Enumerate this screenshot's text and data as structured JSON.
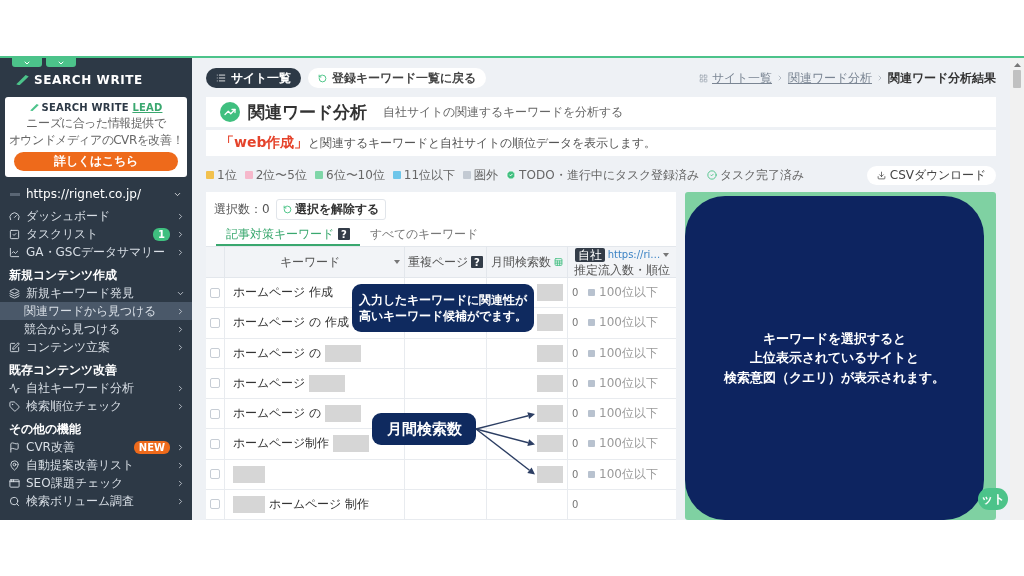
{
  "sidebar": {
    "logo": "SEARCH WRITE",
    "promo": {
      "logo": "SEARCH WRITE",
      "logo_accent": "LEAD",
      "lines": [
        "ニーズに合った情報提供で",
        "オウンドメディアのCVRを改善！"
      ],
      "button": "詳しくはこちら"
    },
    "site": "https://rignet.co.jp/",
    "nav": [
      {
        "kind": "item",
        "label": "ダッシュボード",
        "selected": false
      },
      {
        "kind": "item",
        "label": "タスクリスト",
        "selected": false,
        "badge": {
          "text": "1",
          "color": "#3fbf7f"
        }
      },
      {
        "kind": "item",
        "label": "GA・GSCデータサマリー",
        "selected": false
      },
      {
        "kind": "heading",
        "label": "新規コンテンツ作成"
      },
      {
        "kind": "item",
        "label": "新規キーワード発見",
        "selected": false,
        "expanded": true,
        "children": [
          {
            "label": "関連ワードから見つける",
            "selected": true
          },
          {
            "label": "競合から見つける",
            "selected": false
          }
        ]
      },
      {
        "kind": "item",
        "label": "コンテンツ立案",
        "selected": false
      },
      {
        "kind": "heading",
        "label": "既存コンテンツ改善"
      },
      {
        "kind": "item",
        "label": "自社キーワード分析",
        "selected": false
      },
      {
        "kind": "item",
        "label": "検索順位チェック",
        "selected": false
      },
      {
        "kind": "heading",
        "label": "その他の機能"
      },
      {
        "kind": "item",
        "label": "CVR改善",
        "selected": false,
        "badge": {
          "text": "NEW",
          "color": "#ee6a1b"
        }
      },
      {
        "kind": "item",
        "label": "自動提案改善リスト",
        "selected": false
      },
      {
        "kind": "item",
        "label": "SEO課題チェック",
        "selected": false
      },
      {
        "kind": "item",
        "label": "検索ボリューム調査",
        "selected": false
      }
    ]
  },
  "toolbar": [
    {
      "kind": "primary",
      "label": "サイト一覧"
    },
    {
      "kind": "back",
      "label": "登録キーワード一覧に戻る"
    }
  ],
  "breadcrumb": [
    {
      "kind": "link",
      "label": "サイト一覧"
    },
    {
      "kind": "link",
      "label": "関連ワード分析"
    },
    {
      "kind": "current",
      "label": "関連ワード分析結果"
    }
  ],
  "page_header": {
    "title": "関連ワード分析",
    "subtitle": "自社サイトの関連するキーワードを分析する"
  },
  "notice": {
    "open": "「",
    "keyword": "web作成",
    "close": "」",
    "text": "と関連するキーワードと自社サイトの順位データを表示します。"
  },
  "legend": [
    {
      "kind": "swatch",
      "label": "1位",
      "color": "#f2c14e"
    },
    {
      "kind": "swatch",
      "label": "2位〜5位",
      "color": "#f6b8cb"
    },
    {
      "kind": "swatch",
      "label": "6位〜10位",
      "color": "#7fd6a8"
    },
    {
      "kind": "swatch",
      "label": "11位以下",
      "color": "#6ec6ea"
    },
    {
      "kind": "swatch",
      "label": "圏外",
      "color": "#c3cad3"
    },
    {
      "kind": "task-registered",
      "label": "TODO・進行中にタスク登録済み"
    },
    {
      "kind": "task-done",
      "label": "タスク完了済み"
    }
  ],
  "csv_button": "CSVダウンロード",
  "keyword_table": {
    "selection": "選択数：0",
    "clear_button": "選択を解除する",
    "tabs": [
      {
        "label": "記事対策キーワード",
        "help": "?",
        "selected": true
      },
      {
        "label": "すべてのキーワード",
        "selected": false
      }
    ],
    "columns": [
      {
        "kind": "keyword",
        "label": "キーワード",
        "sortable": true
      },
      {
        "kind": "duplicate",
        "label": "重複ページ",
        "help": "?"
      },
      {
        "kind": "volume",
        "label": "月間検索数"
      },
      {
        "kind": "site",
        "badge": "自社",
        "link": "https://ri…",
        "label": "推定流入数・順位",
        "sortable": true
      }
    ],
    "rows": [
      {
        "checked": false,
        "keyword": [
          {
            "kind": "text",
            "text": "ホームページ 作成"
          }
        ],
        "volume": {
          "kind": "redacted"
        },
        "inflow": "0",
        "rank": "100位以下"
      },
      {
        "checked": false,
        "keyword": [
          {
            "kind": "text",
            "text": "ホームページ の 作成"
          }
        ],
        "volume": {
          "kind": "redacted"
        },
        "inflow": "0",
        "rank": "100位以下"
      },
      {
        "checked": false,
        "keyword": [
          {
            "kind": "text",
            "text": "ホームページ の"
          },
          {
            "kind": "redacted"
          }
        ],
        "volume": {
          "kind": "redacted"
        },
        "inflow": "0",
        "rank": "100位以下"
      },
      {
        "checked": false,
        "keyword": [
          {
            "kind": "text",
            "text": "ホームページ"
          },
          {
            "kind": "redacted"
          }
        ],
        "volume": {
          "kind": "redacted"
        },
        "inflow": "0",
        "rank": "100位以下"
      },
      {
        "checked": false,
        "keyword": [
          {
            "kind": "text",
            "text": "ホームページ の"
          },
          {
            "kind": "redacted"
          }
        ],
        "volume": {
          "kind": "redacted"
        },
        "inflow": "0",
        "rank": "100位以下"
      },
      {
        "checked": false,
        "keyword": [
          {
            "kind": "text",
            "text": "ホームページ制作"
          },
          {
            "kind": "redacted"
          }
        ],
        "volume": {
          "kind": "redacted"
        },
        "inflow": "0",
        "rank": "100位以下"
      },
      {
        "checked": false,
        "keyword": [
          {
            "kind": "redacted"
          }
        ],
        "volume": {
          "kind": "redacted"
        },
        "inflow": "0",
        "rank": "100位以下"
      },
      {
        "checked": false,
        "keyword": [
          {
            "kind": "redacted"
          },
          {
            "kind": "text",
            "text": "ホームページ 制作"
          }
        ],
        "inflow": "0"
      }
    ]
  },
  "callouts": [
    {
      "kind": "plain",
      "lines": [
        "入力したキーワードに関連性が",
        "高いキーワード候補がでます。"
      ]
    },
    {
      "kind": "pointer",
      "lines": [
        "月間検索数"
      ]
    }
  ],
  "detail_panel": {
    "message_lines": [
      "キーワードを選択すると",
      "上位表示されているサイトと",
      "検索意図（クエリ）が表示されます。"
    ],
    "fab": "ット"
  }
}
